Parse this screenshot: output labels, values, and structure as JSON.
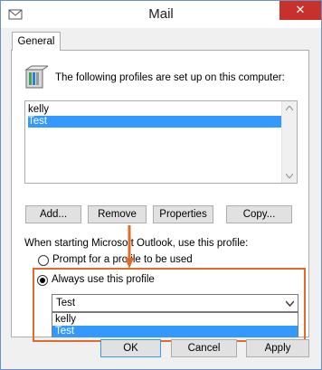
{
  "window": {
    "title": "Mail",
    "close_symbol": "✕"
  },
  "tabs": [
    {
      "label": "General",
      "active": true
    }
  ],
  "general": {
    "intro_text": "The following profiles are set up on this computer:",
    "profiles": [
      {
        "name": "kelly",
        "selected": false
      },
      {
        "name": "Test",
        "selected": true
      }
    ],
    "buttons": {
      "add": "Add...",
      "remove": "Remove",
      "properties": "Properties",
      "copy": "Copy..."
    },
    "startup_label": "When starting Microsoft Outlook, use this profile:",
    "options": {
      "prompt": "Prompt for a profile to be used",
      "always": "Always use this profile",
      "selected": "always"
    },
    "profile_combo": {
      "value": "Test",
      "options": [
        {
          "name": "kelly",
          "selected": false
        },
        {
          "name": "Test",
          "selected": true
        }
      ]
    }
  },
  "footer": {
    "ok": "OK",
    "cancel": "Cancel",
    "apply": "Apply"
  },
  "colors": {
    "selection": "#3399ff",
    "highlight_annotation": "#e06b2a",
    "close_button": "#c7302b"
  }
}
